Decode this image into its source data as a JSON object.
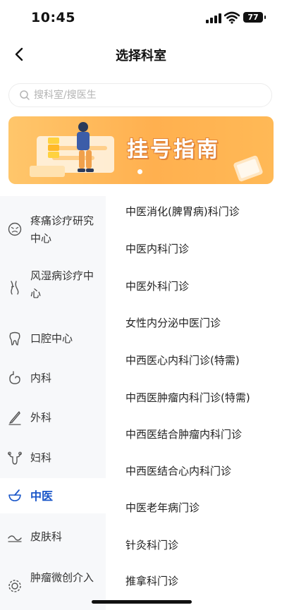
{
  "status_bar": {
    "time": "10:45",
    "battery_level": "77"
  },
  "nav": {
    "title": "选择科室"
  },
  "search": {
    "placeholder": "搜科室/搜医生",
    "value": ""
  },
  "banner": {
    "title": "挂号指南",
    "active_slide": 1,
    "colors": {
      "gradient_start": "#ffc66b",
      "gradient_end": "#ffb04f"
    }
  },
  "sidebar": {
    "active_index": 6,
    "items": [
      {
        "label": "疼痛诊疗研究中心",
        "icon": "face-pain-icon"
      },
      {
        "label": "风湿病诊疗中心",
        "icon": "joint-icon"
      },
      {
        "label": "口腔中心",
        "icon": "tooth-icon"
      },
      {
        "label": "内科",
        "icon": "stomach-icon"
      },
      {
        "label": "外科",
        "icon": "scalpel-icon"
      },
      {
        "label": "妇科",
        "icon": "uterus-icon"
      },
      {
        "label": "中医",
        "icon": "mortar-icon"
      },
      {
        "label": "皮肤科",
        "icon": "skin-icon"
      },
      {
        "label": "肿瘤微创介入",
        "icon": "gear-icon"
      }
    ]
  },
  "departments": [
    "中医消化(脾胃病)科门诊",
    "中医内科门诊",
    "中医外科门诊",
    "女性内分泌中医门诊",
    "中西医心内科门诊(特需)",
    "中西医肿瘤内科门诊(特需)",
    "中西医结合肿瘤内科门诊",
    "中西医结合心内科门诊",
    "中医老年病门诊",
    "针灸科门诊",
    "推拿科门诊"
  ],
  "colors": {
    "accent": "#1a56c9",
    "sidebar_bg": "#f7f8fa",
    "banner_orange": "#ffb04f"
  }
}
